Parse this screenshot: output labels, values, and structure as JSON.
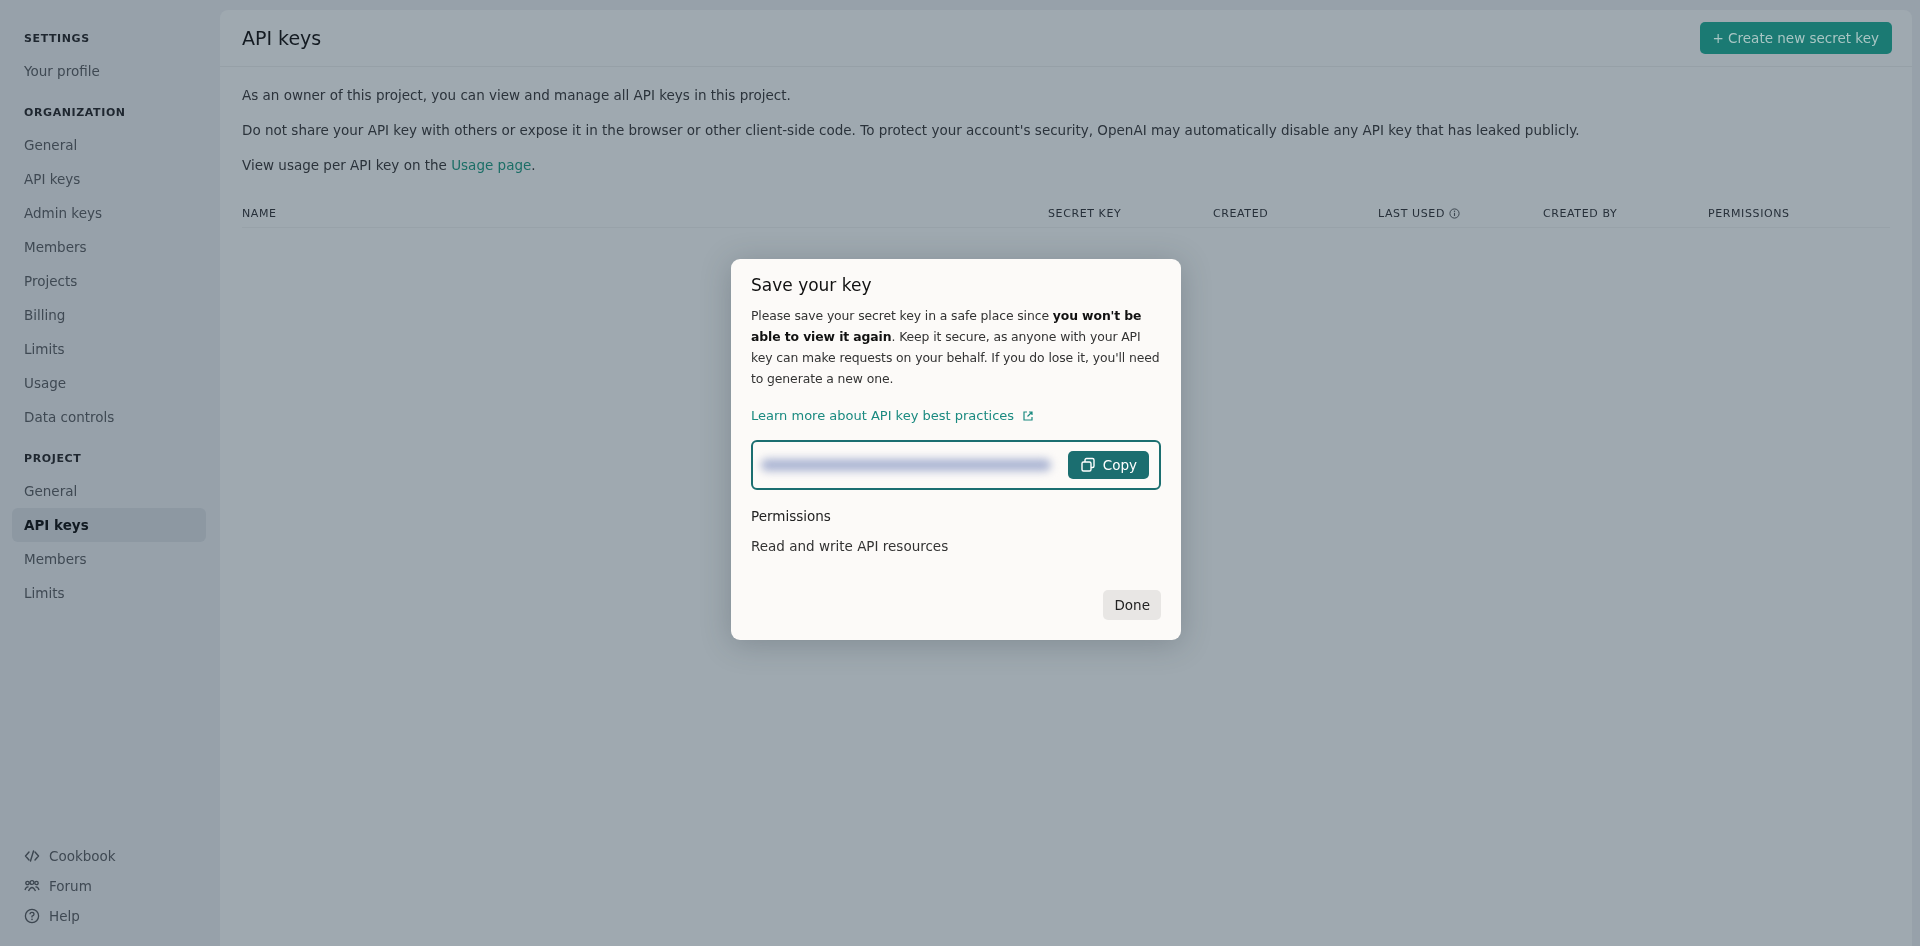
{
  "sidebar": {
    "sections": [
      {
        "heading": "SETTINGS",
        "items": [
          {
            "label": "Your profile",
            "selected": false
          }
        ]
      },
      {
        "heading": "ORGANIZATION",
        "items": [
          {
            "label": "General",
            "selected": false
          },
          {
            "label": "API keys",
            "selected": false
          },
          {
            "label": "Admin keys",
            "selected": false
          },
          {
            "label": "Members",
            "selected": false
          },
          {
            "label": "Projects",
            "selected": false
          },
          {
            "label": "Billing",
            "selected": false
          },
          {
            "label": "Limits",
            "selected": false
          },
          {
            "label": "Usage",
            "selected": false
          },
          {
            "label": "Data controls",
            "selected": false
          }
        ]
      },
      {
        "heading": "PROJECT",
        "items": [
          {
            "label": "General",
            "selected": false
          },
          {
            "label": "API keys",
            "selected": true
          },
          {
            "label": "Members",
            "selected": false
          },
          {
            "label": "Limits",
            "selected": false
          }
        ]
      }
    ],
    "footer": [
      {
        "label": "Cookbook",
        "kind": "code"
      },
      {
        "label": "Forum",
        "kind": "people"
      },
      {
        "label": "Help",
        "kind": "help"
      }
    ]
  },
  "page": {
    "title": "API keys",
    "create_button": "+ Create new secret key",
    "paragraphs": [
      "As an owner of this project, you can view and manage all API keys in this project.",
      "Do not share your API key with others or expose it in the browser or other client-side code. To protect your account's security, OpenAI may automatically disable any API key that has leaked publicly."
    ],
    "usage_text": "View usage per API key on the",
    "usage_link": "Usage page",
    "usage_end": ".",
    "columns": [
      {
        "label": "NAME",
        "info": false
      },
      {
        "label": "SECRET KEY",
        "info": false
      },
      {
        "label": "CREATED",
        "info": false
      },
      {
        "label": "LAST USED",
        "info": true
      },
      {
        "label": "CREATED BY",
        "info": false
      },
      {
        "label": "PERMISSIONS",
        "info": false
      }
    ]
  },
  "dialog": {
    "title": "Save your key",
    "body": "Please save your secret key in a safe place since **you won't be able to view it again**. Keep it secure, as anyone with your API key can make requests on your behalf. If you do lose it, you'll need to generate a new one.",
    "link": "Learn more about API key best practices",
    "copy_button": "Copy",
    "permissions_label": "Permissions",
    "permissions_value": "Read and write API resources",
    "done_button": "Done"
  }
}
